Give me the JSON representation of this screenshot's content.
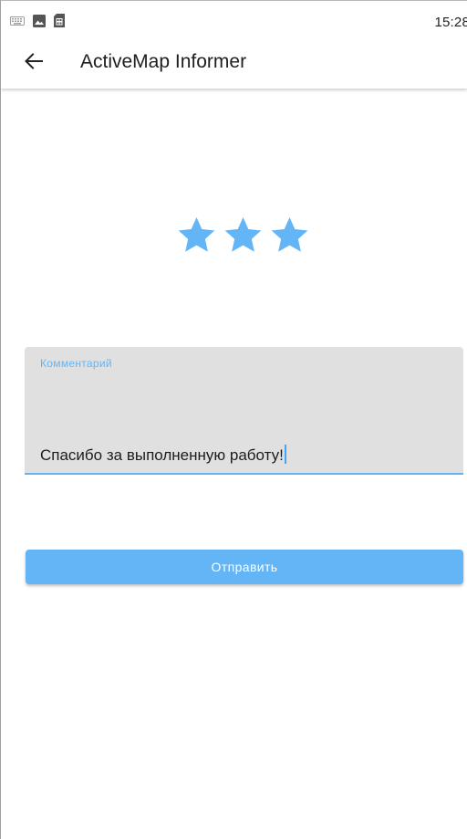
{
  "status_bar": {
    "time": "15:28",
    "icons": [
      "keyboard-icon",
      "image-icon",
      "sim-card-icon"
    ]
  },
  "app_bar": {
    "title": "ActiveMap Informer",
    "back_icon": "arrow-back-icon"
  },
  "rating": {
    "value": 3,
    "max": 3,
    "color": "#64b5f6"
  },
  "comment": {
    "label": "Комментарий",
    "value": "Спасибо за выполненную работу!"
  },
  "submit": {
    "label": "Отправить"
  },
  "colors": {
    "accent": "#64b5f6",
    "field_background": "#e0e0e0"
  }
}
